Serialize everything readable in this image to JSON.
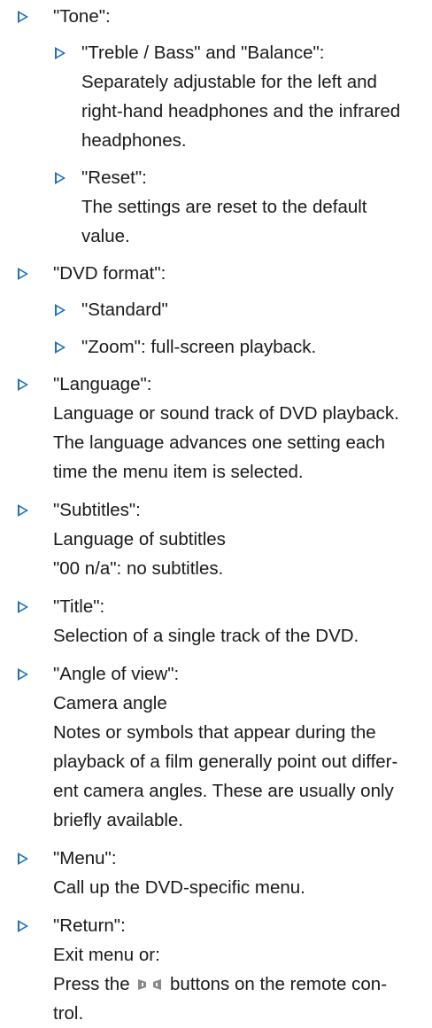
{
  "items": [
    {
      "title": "\"Tone\":",
      "sub_items": [
        {
          "title": "\"Treble / Bass\" and \"Balance\":",
          "lines": [
            "Separately adjustable for the left and",
            "right-hand headphones and the infrared",
            "headphones."
          ]
        },
        {
          "title": "\"Reset\":",
          "lines": [
            "The settings are reset to the default",
            "value."
          ]
        }
      ]
    },
    {
      "title": "\"DVD format\":",
      "sub_items": [
        {
          "title": "\"Standard\""
        },
        {
          "title": "\"Zoom\": full-screen playback."
        }
      ]
    },
    {
      "title": "\"Language\":",
      "lines": [
        "Language or sound track of DVD playback.",
        "The language advances one setting each",
        "time the menu item is selected."
      ]
    },
    {
      "title": "\"Subtitles\":",
      "lines": [
        "Language of subtitles",
        "\"00 n/a\": no subtitles."
      ]
    },
    {
      "title": "\"Title\":",
      "lines": [
        "Selection of a single track of the DVD."
      ]
    },
    {
      "title": "\"Angle of view\":",
      "lines": [
        "Camera angle",
        "Notes or symbols that appear during the",
        "playback of a film generally point out differ-",
        "ent camera angles. These are usually only",
        "briefly available."
      ]
    },
    {
      "title": "\"Menu\":",
      "lines": [
        "Call up the DVD-specific menu."
      ]
    },
    {
      "title": "\"Return\":",
      "lines": [
        "Exit menu or:"
      ],
      "press_line": {
        "before": "Press the",
        "after": "buttons on the remote con-",
        "icons": [
          "remote-button-left-icon",
          "remote-button-right-icon"
        ]
      },
      "last_line": "trol."
    }
  ],
  "colors": {
    "bullet": "#1e6fb8",
    "text": "#1a1a1a",
    "button_icon": "#8a8a8a"
  }
}
